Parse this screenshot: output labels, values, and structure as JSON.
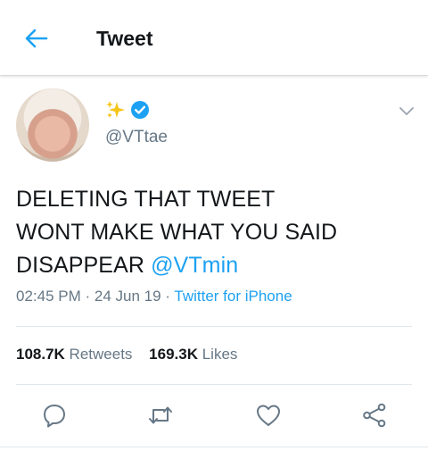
{
  "header": {
    "title": "Tweet",
    "back_icon": "back-arrow-icon"
  },
  "colors": {
    "accent": "#1da1f2",
    "text": "#14171a",
    "muted": "#657786"
  },
  "user": {
    "display_icons": [
      "sparkles-emoji-icon",
      "verified-badge-icon"
    ],
    "handle": "@VTtae"
  },
  "tweet": {
    "line1": "DELETING THAT TWEET",
    "line2": "WONT MAKE WHAT YOU SAID",
    "line3_text": "DISAPPEAR ",
    "mention": "@VTmin",
    "time": "02:45 PM",
    "sep1": " · ",
    "date": "24 Jun 19",
    "sep2": " · ",
    "source": "Twitter for iPhone"
  },
  "stats": {
    "retweets_count": "108.7K",
    "retweets_label": " Retweets",
    "likes_count": "169.3K",
    "likes_label": " Likes"
  },
  "actions": [
    "reply-icon",
    "retweet-icon",
    "like-icon",
    "share-icon"
  ]
}
